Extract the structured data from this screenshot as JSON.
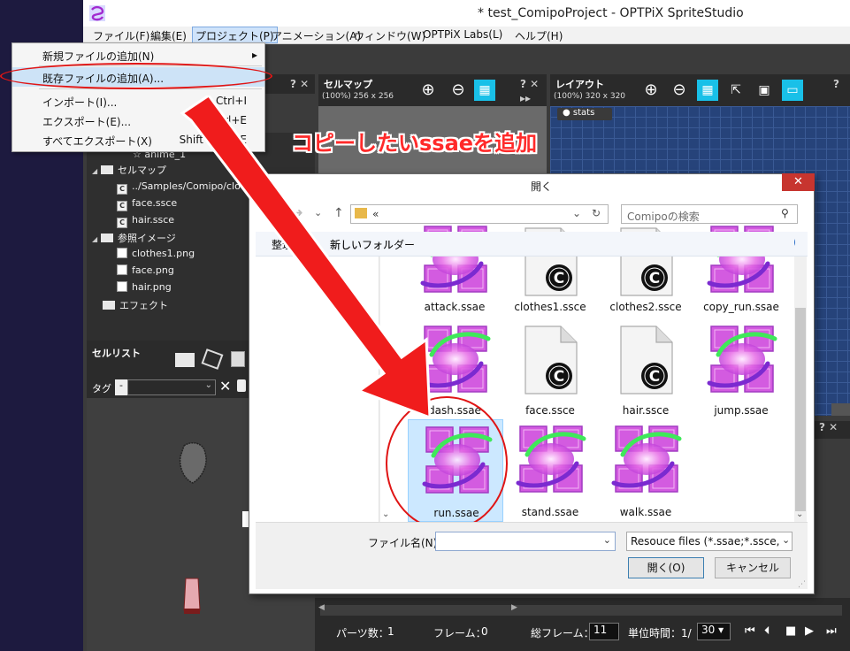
{
  "window": {
    "title": "* test_ComipoProject - OPTPiX SpriteStudio"
  },
  "menubar": [
    "ファイル(F)",
    "編集(E)",
    "プロジェクト(P)",
    "アニメーション(A)",
    "ウィンドウ(W)",
    "OPTPiX Labs(L)",
    "ヘルプ(H)"
  ],
  "project_menu": {
    "items": [
      {
        "label": "新規ファイルの追加(N)",
        "shortcut": "",
        "submenu_arrow": "▸"
      },
      {
        "label": "既存ファイルの追加(A)...",
        "shortcut": ""
      },
      {
        "label": "インポート(I)...",
        "shortcut": "Ctrl+I"
      },
      {
        "label": "エクスポート(E)...",
        "shortcut": "Ctrl+E"
      },
      {
        "label": "すべてエクスポート(X)",
        "shortcut": "Shift+Ctrl+E"
      }
    ]
  },
  "tree": {
    "anime_item": "anime_1",
    "cellmap_folder": "セルマップ",
    "cellmap_items": [
      "../Samples/Comipo/clo",
      "face.ssce",
      "hair.ssce"
    ],
    "ref_folder": "参照イメージ",
    "ref_items": [
      "clothes1.png",
      "face.png",
      "hair.png"
    ],
    "effect_folder": "エフェクト"
  },
  "cell_list": {
    "title": "セルリスト",
    "tag_label": "タグ",
    "tag_value": "-"
  },
  "cellmap_panel": {
    "title": "セルマップ",
    "info": "(100%) 256 x 256"
  },
  "layout_panel": {
    "title": "レイアウト",
    "info": "(100%) 320 x 320",
    "stats_tab": "● stats"
  },
  "timeline": {
    "parts_label": "パーツ数：",
    "parts_value": "1",
    "frame_label": "フレーム：",
    "frame_value": "0",
    "total_label": "総フレーム：",
    "total_value": "11",
    "unit_label": "単位時間：1/",
    "unit_value": "30"
  },
  "annotation": "コピーしたいssaeを追加",
  "dialog": {
    "title": "開く",
    "address_sep": "«",
    "search_placeholder": "Comipoの検索",
    "organize": "整理",
    "new_folder": "新しいフォルダー",
    "files_row0": [
      "attack.ssae",
      "clothes1.ssce",
      "clothes2.ssce",
      "copy_run.ssae"
    ],
    "files_row1": [
      "dash.ssae",
      "face.ssce",
      "hair.ssce",
      "jump.ssae"
    ],
    "files_row2": [
      "run.ssae",
      "stand.ssae",
      "walk.ssae"
    ],
    "filename_label": "ファイル名(N):",
    "filename_value": "",
    "filter": "Resouce files (*.ssae;*.ssce,",
    "open_button": "開く(O)",
    "cancel_button": "キャンセル"
  }
}
